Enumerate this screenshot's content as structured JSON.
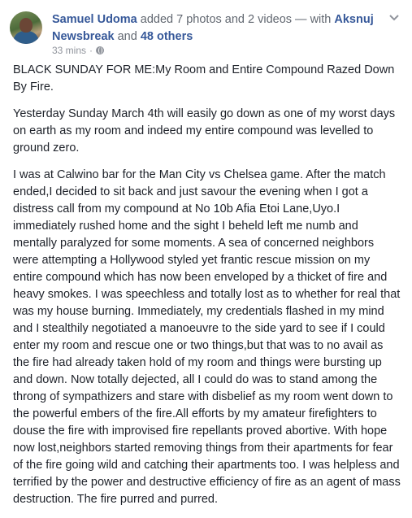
{
  "post": {
    "author": "Samuel Udoma",
    "action_text": "added 7 photos and 2 videos — with",
    "tagged_user": "Aksnuj Newsbreak",
    "and_text": "and",
    "others_link": "48 others",
    "timestamp": "33 mins",
    "separator": "·",
    "privacy_icon": "globe-icon",
    "menu_icon": "chevron-down-icon",
    "paragraphs": [
      "BLACK SUNDAY FOR ME:My Room and Entire Compound Razed Down By Fire.",
      "Yesterday Sunday March 4th will easily go down as one of my worst days on earth as my room and indeed my entire compound was levelled to ground zero.",
      "I was at Calwino bar for the Man City vs Chelsea game. After the match ended,I decided to sit back and just savour the evening when I got a distress call from my compound at No 10b Afia Etoi Lane,Uyo.I immediately rushed home and the sight I beheld left me numb and mentally paralyzed for some moments. A sea of concerned neighbors were attempting a Hollywood styled yet frantic rescue mission on my entire compound which has now been enveloped by a thicket of fire and heavy smokes. I was speechless and totally lost as to whether for real that was my house burning. Immediately, my credentials flashed in my mind and I stealthily negotiated a manoeuvre to the side yard to see if I could enter my room and rescue one or two things,but that was to no avail as the fire had already taken hold of my room and things were bursting up and down. Now totally dejected, all I could do was to stand among the throng of sympathizers and stare with disbelief as my room went down to the powerful embers of the fire.All efforts by my amateur firefighters to douse the fire with improvised fire repellants proved abortive. With hope now lost,neighbors started removing things from their apartments for fear of the fire going wild and catching their apartments too. I was helpless and terrified by the power and destructive efficiency of fire as an agent of mass destruction. The fire purred and purred."
    ]
  },
  "colors": {
    "link": "#365899",
    "text": "#1d2129",
    "meta": "#90949c"
  }
}
